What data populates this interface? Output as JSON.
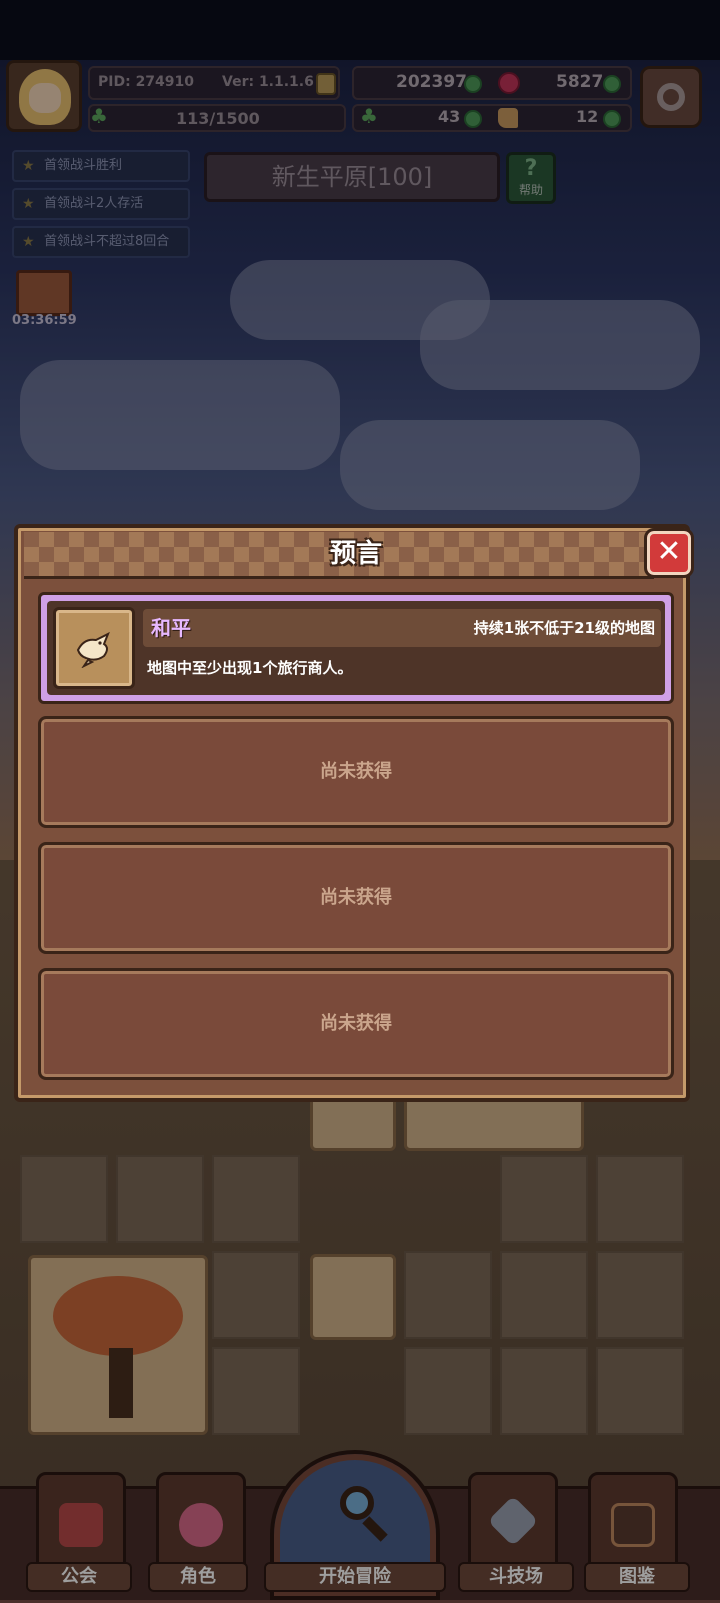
{
  "hud": {
    "pid": "PID: 274910",
    "version": "Ver: 1.1.1.6",
    "gold": "202397",
    "ruby": "5827",
    "exp": "113/1500",
    "clover": "43",
    "stamina": "12"
  },
  "quests": [
    "首领战斗胜利",
    "首领战斗2人存活",
    "首领战斗不超过8回合"
  ],
  "gift_timer": "03:36:59",
  "region": {
    "name": "新生平原[100]",
    "help_label": "帮助"
  },
  "modal": {
    "title": "预言",
    "close_symbol": "✕",
    "prophecy": {
      "name": "和平",
      "condition": "持续1张不低于21级的地图",
      "description": "地图中至少出现1个旅行商人。",
      "icon": "dove-icon"
    },
    "locked_slots": [
      "尚未获得",
      "尚未获得",
      "尚未获得"
    ]
  },
  "nav": {
    "guild": "公会",
    "character": "角色",
    "adventure": "开始冒险",
    "arena": "斗技场",
    "codex": "图鉴"
  },
  "colors": {
    "prophecy_name": "#e7b8ff",
    "close_button": "#d23a3a",
    "modal_bg": "#7c503c"
  }
}
